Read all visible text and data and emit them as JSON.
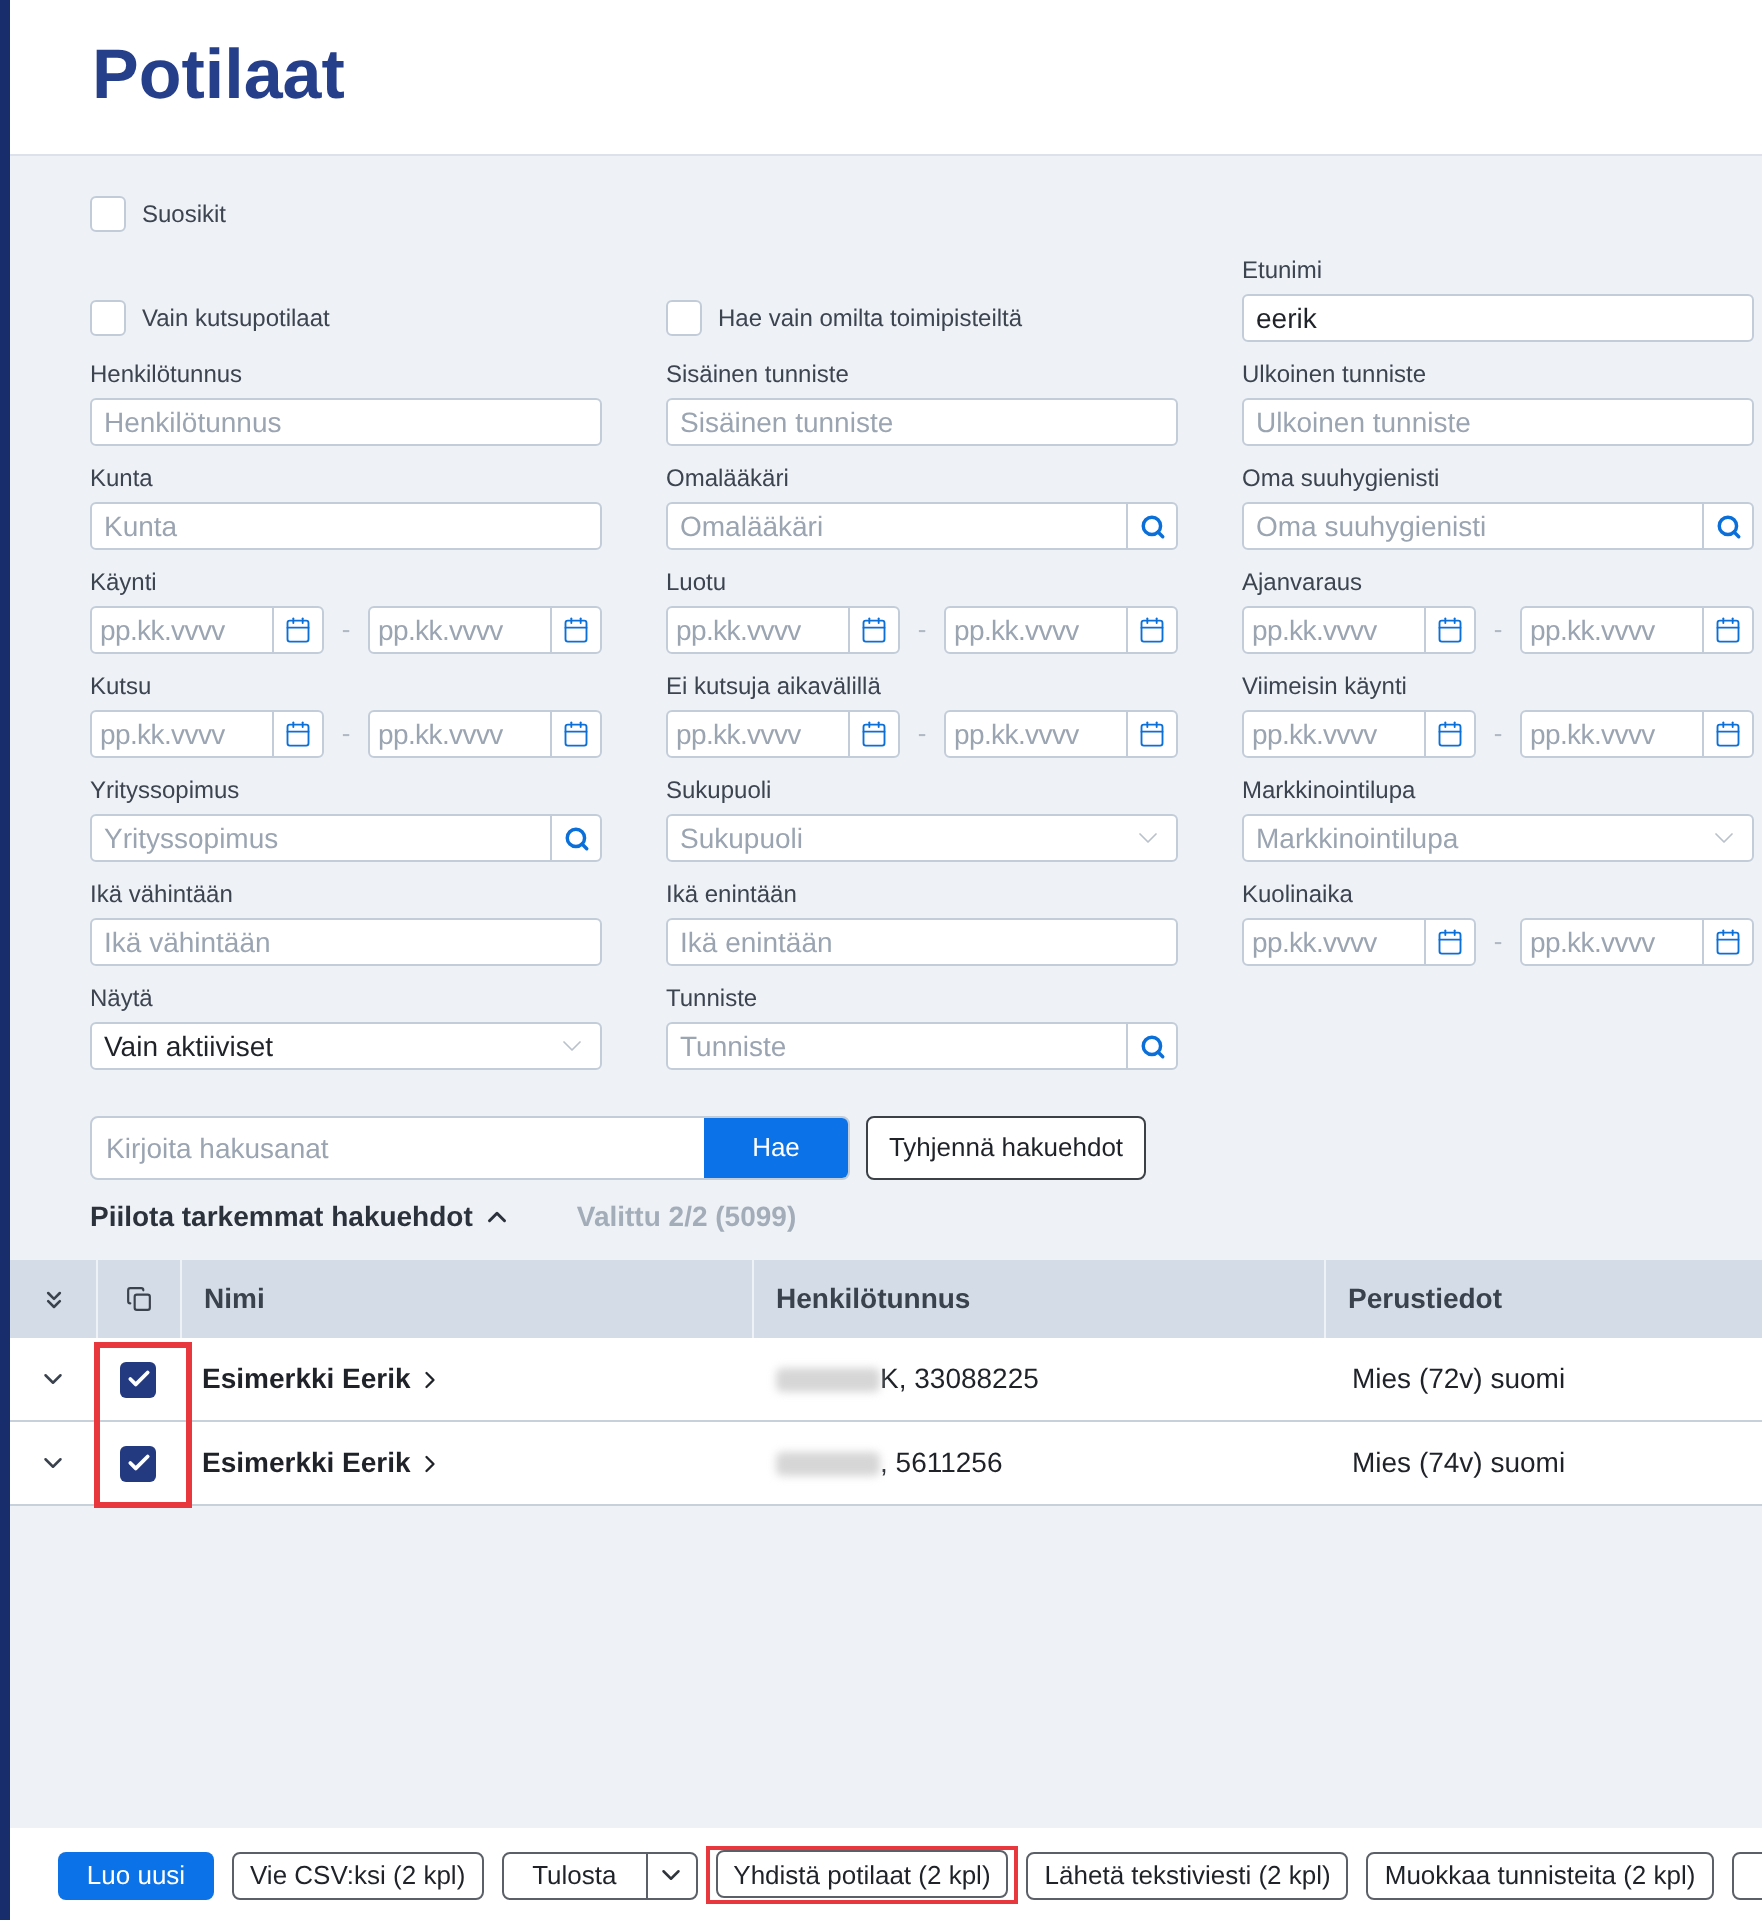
{
  "page": {
    "title": "Potilaat"
  },
  "filter_rows": [
    [
      {
        "kind": "checkbox",
        "label": "Suosikit",
        "checked": false
      }
    ],
    [
      {
        "kind": "checkbox",
        "label": "Vain kutsupotilaat",
        "checked": false
      },
      {
        "kind": "checkbox",
        "label": "Hae vain omilta toimipisteiltä",
        "checked": false
      },
      {
        "kind": "text",
        "label": "Etunimi",
        "value": "eerik"
      }
    ],
    [
      {
        "kind": "text",
        "label": "Henkilötunnus",
        "placeholder": "Henkilötunnus"
      },
      {
        "kind": "text",
        "label": "Sisäinen tunniste",
        "placeholder": "Sisäinen tunniste"
      },
      {
        "kind": "text",
        "label": "Ulkoinen tunniste",
        "placeholder": "Ulkoinen tunniste"
      }
    ],
    [
      {
        "kind": "text",
        "label": "Kunta",
        "placeholder": "Kunta"
      },
      {
        "kind": "search",
        "label": "Omalääkäri",
        "placeholder": "Omalääkäri"
      },
      {
        "kind": "search",
        "label": "Oma suuhygienisti",
        "placeholder": "Oma suuhygienisti"
      }
    ],
    [
      {
        "kind": "date_range",
        "label": "Käynti",
        "from_placeholder": "pp.kk.vvvv",
        "separator": "-",
        "to_placeholder": "pp.kk.vvvv"
      },
      {
        "kind": "date_range",
        "label": "Luotu",
        "from_placeholder": "pp.kk.vvvv",
        "separator": "-",
        "to_placeholder": "pp.kk.vvvv"
      },
      {
        "kind": "date_range",
        "label": "Ajanvaraus",
        "from_placeholder": "pp.kk.vvvv",
        "separator": "-",
        "to_placeholder": "pp.kk.vvvv"
      }
    ],
    [
      {
        "kind": "date_range",
        "label": "Kutsu",
        "from_placeholder": "pp.kk.vvvv",
        "separator": "-",
        "to_placeholder": "pp.kk.vvvv"
      },
      {
        "kind": "date_range",
        "label": "Ei kutsuja aikavälillä",
        "from_placeholder": "pp.kk.vvvv",
        "separator": "-",
        "to_placeholder": "pp.kk.vvvv"
      },
      {
        "kind": "date_range",
        "label": "Viimeisin käynti",
        "from_placeholder": "pp.kk.vvvv",
        "separator": "-",
        "to_placeholder": "pp.kk.vvvv"
      }
    ],
    [
      {
        "kind": "search",
        "label": "Yrityssopimus",
        "placeholder": "Yrityssopimus"
      },
      {
        "kind": "select",
        "label": "Sukupuoli",
        "placeholder": "Sukupuoli"
      },
      {
        "kind": "select",
        "label": "Markkinointilupa",
        "placeholder": "Markkinointilupa"
      }
    ],
    [
      {
        "kind": "text",
        "label": "Ikä vähintään",
        "placeholder": "Ikä vähintään"
      },
      {
        "kind": "text",
        "label": "Ikä enintään",
        "placeholder": "Ikä enintään"
      },
      {
        "kind": "date_range",
        "label": "Kuolinaika",
        "from_placeholder": "pp.kk.vvvv",
        "separator": "-",
        "to_placeholder": "pp.kk.vvvv"
      }
    ],
    [
      {
        "kind": "select",
        "label": "Näytä",
        "value": "Vain aktiiviset"
      },
      {
        "kind": "search",
        "label": "Tunniste",
        "placeholder": "Tunniste"
      }
    ]
  ],
  "search_bar": {
    "placeholder": "Kirjoita hakusanat",
    "submit": "Hae",
    "clear": "Tyhjennä hakuehdot"
  },
  "toggle": {
    "label": "Piilota tarkemmat hakuehdot",
    "expanded": true
  },
  "selection_summary": "Valittu 2/2 (5099)",
  "table": {
    "columns": [
      {
        "label": "Nimi"
      },
      {
        "label": "Henkilötunnus"
      },
      {
        "label": "Perustiedot"
      }
    ],
    "checkbox_column_highlighted": true,
    "rows": [
      {
        "name": "Esimerkki Eerik",
        "selected": true,
        "id_redacted": true,
        "id_text": "K, 33088225",
        "details": "Mies (72v) suomi"
      },
      {
        "name": "Esimerkki Eerik",
        "selected": true,
        "id_redacted": true,
        "id_text": ", 5611256",
        "details": "Mies (74v) suomi"
      }
    ]
  },
  "actions": [
    {
      "kind": "primary",
      "label": "Luo uusi",
      "highlighted": false
    },
    {
      "kind": "default",
      "label": "Vie CSV:ksi (2 kpl)",
      "highlighted": false
    },
    {
      "kind": "split",
      "label": "Tulosta",
      "highlighted": false
    },
    {
      "kind": "default",
      "label": "Yhdistä potilaat (2 kpl)",
      "highlighted": true
    },
    {
      "kind": "default",
      "label": "Lähetä tekstiviesti (2 kpl)",
      "highlighted": false
    },
    {
      "kind": "default",
      "label": "Muokkaa tunnisteita (2 kpl)",
      "highlighted": false
    }
  ]
}
